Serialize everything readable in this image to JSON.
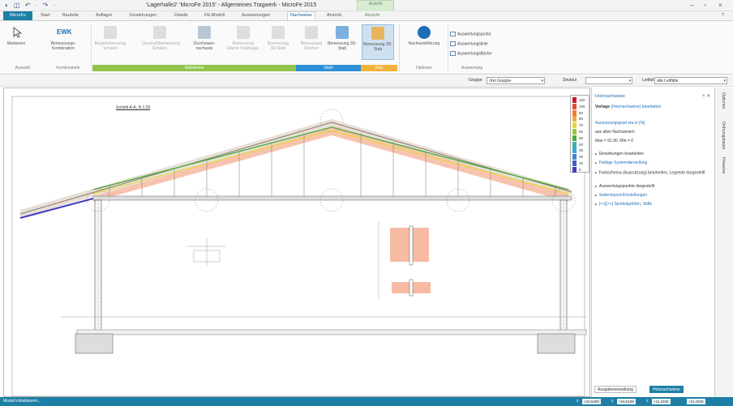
{
  "window": {
    "title": "'Lagerhalle2' 'MicroFe 2015' - Allgemeines Tragwerk - MicroFe 2015",
    "context_tab": "Ansicht",
    "quick_access": "◐ ◫ ↶ · ↷ ·",
    "controls": {
      "minimize": "–",
      "maximize": "▫",
      "close": "×",
      "help": "?"
    }
  },
  "tabs": [
    "MicroFe",
    "Start",
    "Bauteile",
    "Auflager",
    "Einwirkungen",
    "Details",
    "FE-Modell",
    "Auswertungen",
    "Nachweise",
    "Ansicht",
    "Ansicht"
  ],
  "active_tab_index": 8,
  "ribbon": {
    "buttons": [
      {
        "label": "Markieren",
        "state": "normal"
      },
      {
        "label": "EWK",
        "sub": "Bemessungs-Kombination",
        "state": "normal"
      },
      {
        "label": "Biegebemessung Schalen",
        "state": "dim"
      },
      {
        "label": "Querkraftbemessung Schalen",
        "state": "dim"
      },
      {
        "label": "Durchstanz-nachweis",
        "state": "normal"
      },
      {
        "label": "Bemessung Ebene Stabtragw.",
        "state": "dim"
      },
      {
        "label": "Bemessung 3D-Stab",
        "state": "dim"
      },
      {
        "label": "Bemessung Flächen",
        "state": "dim"
      },
      {
        "label": "Bemessung 3D-Stab",
        "state": "normal"
      },
      {
        "label": "Bemessung 3D-Stab",
        "state": "selected"
      },
      {
        "label": "Nachweisführung",
        "state": "normal"
      }
    ],
    "groups": [
      {
        "label": "Auswahl",
        "color": "#f3f3f3"
      },
      {
        "label": "Kombinatorik",
        "color": "#f3f3f3"
      },
      {
        "label": "Stahlbeton",
        "color": "#8fc34a"
      },
      {
        "label": "Stahl",
        "color": "#2e8fd6"
      },
      {
        "label": "Holz",
        "color": "#f0b43c"
      },
      {
        "label": "Optionen",
        "color": "#f3f3f3"
      },
      {
        "label": "Auswertung",
        "color": "#f3f3f3"
      }
    ],
    "small_buttons": [
      "Auswertungspunkt",
      "Auswertungslinie",
      "Auswertungsfläche"
    ]
  },
  "filterbar": {
    "gruppe_label": "Gruppe",
    "gruppe_value": "-frei Gruppe-",
    "struktur_label": "Struktur",
    "struktur_value": "",
    "leitfall_label": "Leitfall",
    "leitfall_value": "alle Leitfälle"
  },
  "canvas": {
    "section_label": "Schnitt A-A, N 1:20",
    "legend": {
      "title": "",
      "values": [
        "100",
        "100",
        "90",
        "80",
        "70",
        "60",
        "50",
        "40",
        "30",
        "20",
        "10",
        "0"
      ],
      "colors": [
        "#c8192c",
        "#e64a2e",
        "#f07a2b",
        "#f4a63a",
        "#e7d83a",
        "#9ac93b",
        "#4aae3e",
        "#3ab5a0",
        "#38a8d6",
        "#3b84d6",
        "#3c5ed0",
        "#3f3dc2"
      ]
    }
  },
  "panel": {
    "title": "Holznachweise",
    "subtitle_a": "Vorlage",
    "subtitle_b": "(Holznachweise) bearbeiten",
    "metric": "Ausnutzungsgrad eta.m [%]",
    "scope": "aus allen Nachweisen",
    "range": "Max = 91.90, Min = 0",
    "items": [
      "Einwirkungen bearbeiten",
      "Farbige Systemdarstellung",
      "Farbschema (Ausnutzung) bearbeiten, Legende dargestellt",
      "Auswertungspunkte dargestellt",
      "Seitenlayout-Einstellungen",
      "[<<][>>] Symbolgrößen, Stifte"
    ],
    "vertical_tabs": [
      "Optionen",
      "Ordnungsbaum",
      "Hinweise"
    ],
    "bottom_tabs": [
      "Ausgabeverwaltung",
      "Holznachweise"
    ]
  },
  "status": {
    "message": "Modell initialisieren...",
    "coords": [
      {
        "label": "x",
        "value": "+10.6450"
      },
      {
        "label": "y",
        "value": "+16.5196"
      },
      {
        "label": "z",
        "value": "+11.2330"
      },
      {
        "label": "",
        "value": "+11.2330"
      }
    ]
  }
}
